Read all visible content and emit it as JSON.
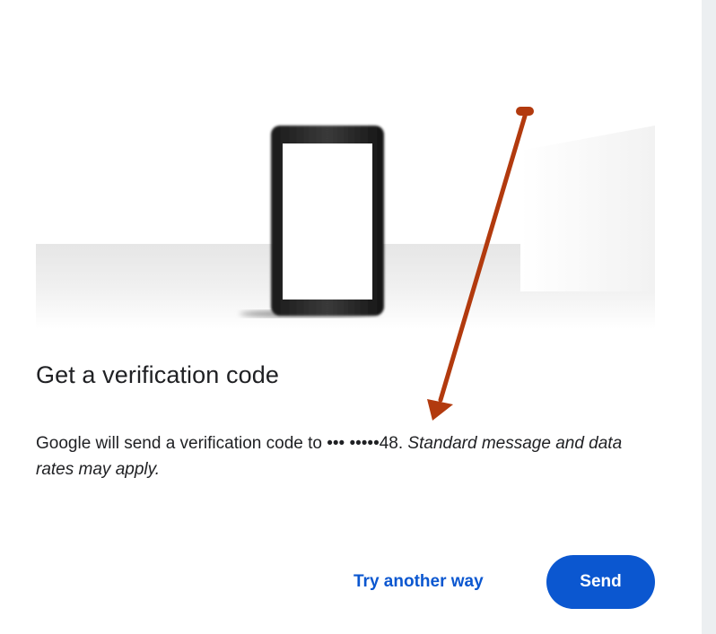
{
  "dialog": {
    "title": "Get a verification code",
    "message_main": "Google will send a verification code to ••• •••••48.",
    "message_note": "Standard message and data rates may apply."
  },
  "actions": {
    "try_another_label": "Try another way",
    "send_label": "Send"
  },
  "icons": {
    "hero": "phone-illustration",
    "annotation": "red-arrow"
  },
  "colors": {
    "primary": "#0b57d0",
    "text": "#202124",
    "annotation": "#b23a0e"
  }
}
